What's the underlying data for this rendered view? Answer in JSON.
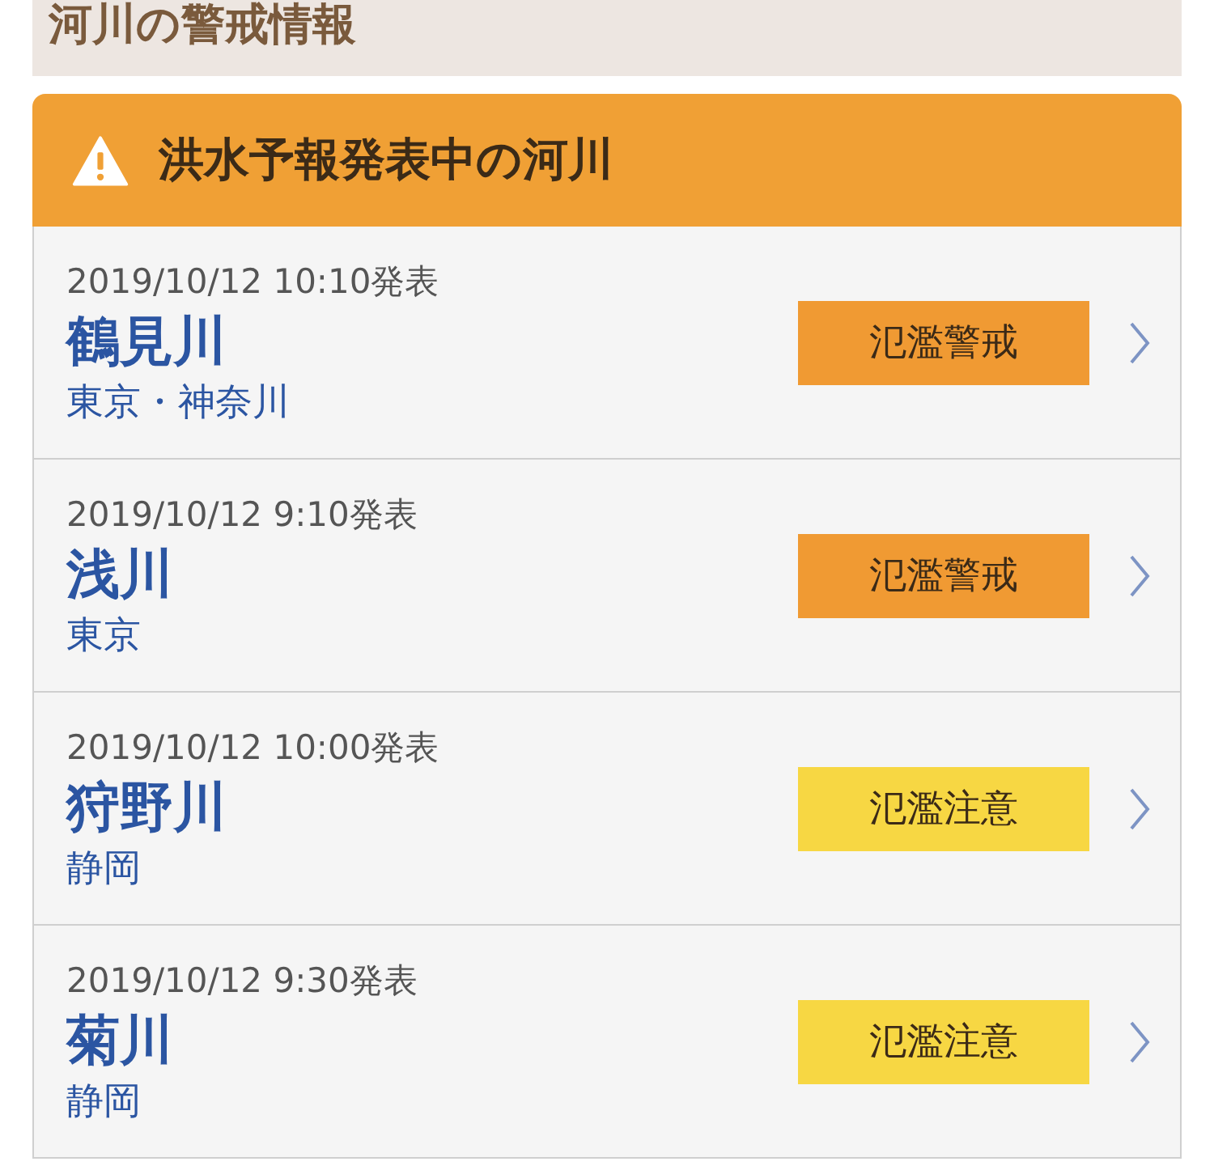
{
  "section_title": "河川の警戒情報",
  "card": {
    "title": "洪水予報発表中の河川",
    "rows": [
      {
        "issued": "2019/10/12 10:10発表",
        "river": "鶴見川",
        "region": "東京・神奈川",
        "status": "氾濫警戒",
        "color": "#f09a33"
      },
      {
        "issued": "2019/10/12 9:10発表",
        "river": "浅川",
        "region": "東京",
        "status": "氾濫警戒",
        "color": "#f09a33"
      },
      {
        "issued": "2019/10/12 10:00発表",
        "river": "狩野川",
        "region": "静岡",
        "status": "氾濫注意",
        "color": "#f7d743"
      },
      {
        "issued": "2019/10/12 9:30発表",
        "river": "菊川",
        "region": "静岡",
        "status": "氾濫注意",
        "color": "#f7d743"
      }
    ]
  }
}
